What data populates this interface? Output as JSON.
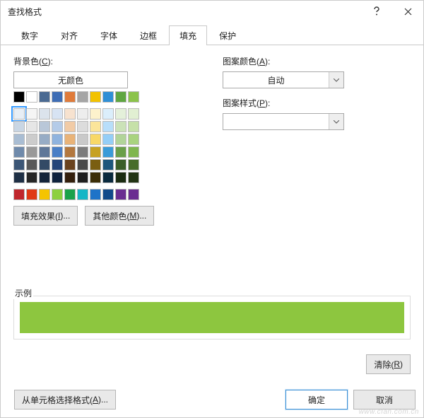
{
  "titlebar": {
    "title": "查找格式"
  },
  "tabs": {
    "items": [
      {
        "label": "数字"
      },
      {
        "label": "对齐"
      },
      {
        "label": "字体"
      },
      {
        "label": "边框"
      },
      {
        "label": "填充"
      },
      {
        "label": "保护"
      }
    ],
    "active_index": 4
  },
  "fill": {
    "bgcolor_label_pre": "背景色(",
    "bgcolor_label_key": "C",
    "bgcolor_label_post": "):",
    "no_color_label": "无颜色",
    "row1": [
      "#000000",
      "#ffffff",
      "#4a6a92",
      "#3e6db5",
      "#e07b3a",
      "#a5a5a5",
      "#f2c200",
      "#2f8fd6",
      "#5fa641",
      "#8bc34a"
    ],
    "grid": [
      "#e8eef5",
      "#f5f5f5",
      "#dbe3ec",
      "#d7e3f3",
      "#f7e2cf",
      "#ededed",
      "#fdf2cc",
      "#dbeefb",
      "#e4f0da",
      "#e1efd2",
      "#c9d6e4",
      "#e6e6e6",
      "#b9c7d8",
      "#b4cbe8",
      "#f1cba6",
      "#dcdcdc",
      "#fbe59a",
      "#b8defa",
      "#cbe2b8",
      "#c6e1a8",
      "#a9bdd3",
      "#cccccc",
      "#97acc5",
      "#8fb3de",
      "#e9b378",
      "#c9c9c9",
      "#f8d867",
      "#94cef7",
      "#b1d499",
      "#a9d37f",
      "#6f8aab",
      "#999999",
      "#5f7798",
      "#4a7fc6",
      "#b3783f",
      "#7c7c7c",
      "#c6a122",
      "#3a9bd8",
      "#6a9f4a",
      "#7fb64e",
      "#3c5676",
      "#595959",
      "#334a66",
      "#24457a",
      "#6a431f",
      "#4a4a4a",
      "#7a5e11",
      "#1d567c",
      "#3b5e28",
      "#486c2a",
      "#1e2f45",
      "#262626",
      "#14243a",
      "#0f223d",
      "#331f0d",
      "#1f1f1f",
      "#3b2d07",
      "#0a2a3e",
      "#1b2c11",
      "#223413"
    ],
    "accent_row": [
      "#c0272d",
      "#e03a16",
      "#f5c400",
      "#8dd03f",
      "#1aa24a",
      "#16b6c6",
      "#1e73c8",
      "#114a8a",
      "#6a2e91",
      "#6a2e91"
    ],
    "effects_btn_pre": "填充效果(",
    "effects_btn_key": "I",
    "effects_btn_post": ")...",
    "more_btn_pre": "其他颜色(",
    "more_btn_key": "M",
    "more_btn_post": ")..."
  },
  "pattern": {
    "color_label_pre": "图案颜色(",
    "color_label_key": "A",
    "color_label_post": "):",
    "color_value": "自动",
    "style_label_pre": "图案样式(",
    "style_label_key": "P",
    "style_label_post": "):",
    "style_value": ""
  },
  "example": {
    "label": "示例",
    "color": "#8dc63f"
  },
  "clear": {
    "pre": "清除(",
    "key": "R",
    "post": ")"
  },
  "footer": {
    "from_cell_pre": "从单元格选择格式(",
    "from_cell_key": "A",
    "from_cell_post": ")...",
    "ok": "确定",
    "cancel": "取消"
  },
  "watermark": "www.cfan.com.cn"
}
